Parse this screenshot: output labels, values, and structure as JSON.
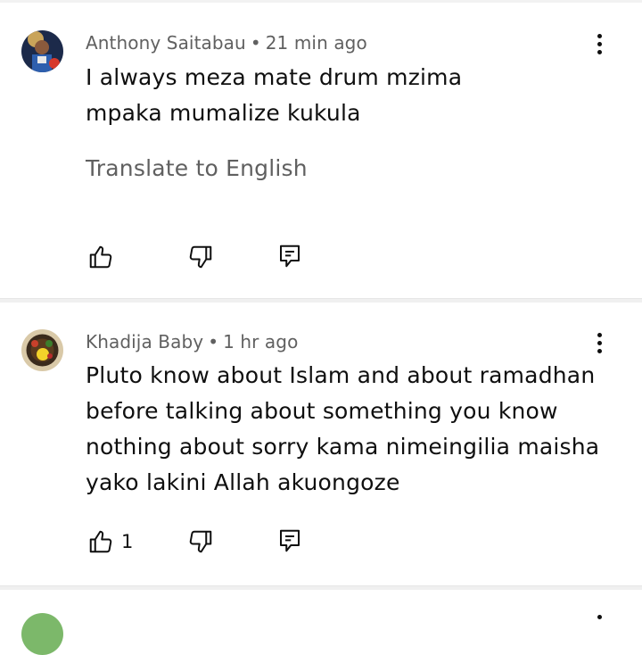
{
  "comments": [
    {
      "author": "Anthony Saitabau",
      "separator": "•",
      "time": "21 min ago",
      "text": "I always meza mate drum mzima mpaka mumalize kukula",
      "translate": "Translate to English"
    },
    {
      "author": "Khadija Baby",
      "separator": "•",
      "time": "1 hr ago",
      "text": "Pluto know about Islam and about ramadhan before talking about something you know nothing about sorry kama nimeingilia maisha yako lakini Allah akuongoze",
      "like_count": "1"
    }
  ],
  "icons": {
    "like": "thumbs-up-icon",
    "dislike": "thumbs-down-icon",
    "reply": "reply-icon",
    "more": "more-vert-icon"
  },
  "colors": {
    "text": "#0f0f0f",
    "secondary": "#606060",
    "divider": "#f0f0f0"
  }
}
